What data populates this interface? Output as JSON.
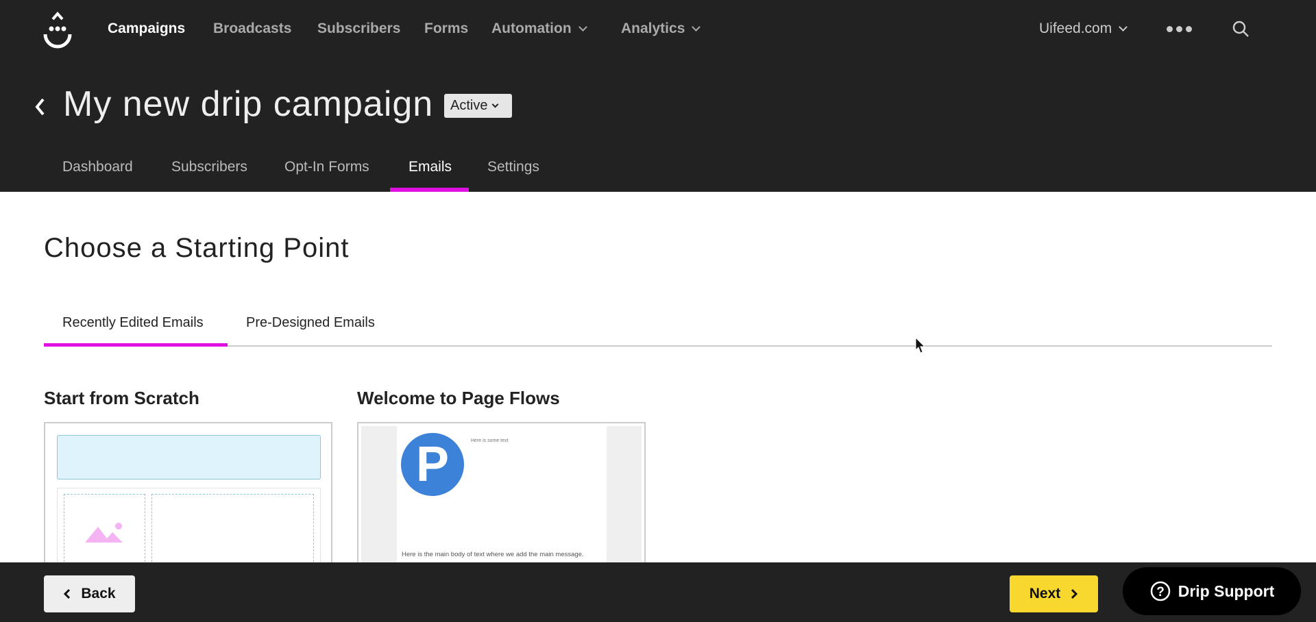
{
  "nav": {
    "items": [
      {
        "label": "Campaigns",
        "active": true
      },
      {
        "label": "Broadcasts"
      },
      {
        "label": "Subscribers"
      },
      {
        "label": "Forms"
      },
      {
        "label": "Automation",
        "dropdown": true
      },
      {
        "label": "Analytics",
        "dropdown": true
      }
    ],
    "account": "Uifeed.com",
    "more_icon": "more-dots-icon",
    "search_icon": "search-icon"
  },
  "campaign": {
    "title": "My new drip campaign",
    "status": "Active"
  },
  "tabs": [
    {
      "label": "Dashboard"
    },
    {
      "label": "Subscribers"
    },
    {
      "label": "Opt-In Forms"
    },
    {
      "label": "Emails",
      "active": true
    },
    {
      "label": "Settings"
    }
  ],
  "main": {
    "heading": "Choose a Starting Point",
    "tabs": [
      {
        "label": "Recently Edited Emails",
        "active": true
      },
      {
        "label": "Pre-Designed Emails"
      }
    ],
    "templates": [
      {
        "title": "Start from Scratch"
      },
      {
        "title": "Welcome to Page Flows",
        "preview_small_text": "Here is some text",
        "preview_body": "Here is the main body of text where we add the main message."
      }
    ]
  },
  "footer": {
    "back": "Back",
    "next": "Next",
    "support": "Drip Support"
  },
  "colors": {
    "accent": "#e010e0",
    "next": "#f8d82e",
    "header": "#222222"
  }
}
